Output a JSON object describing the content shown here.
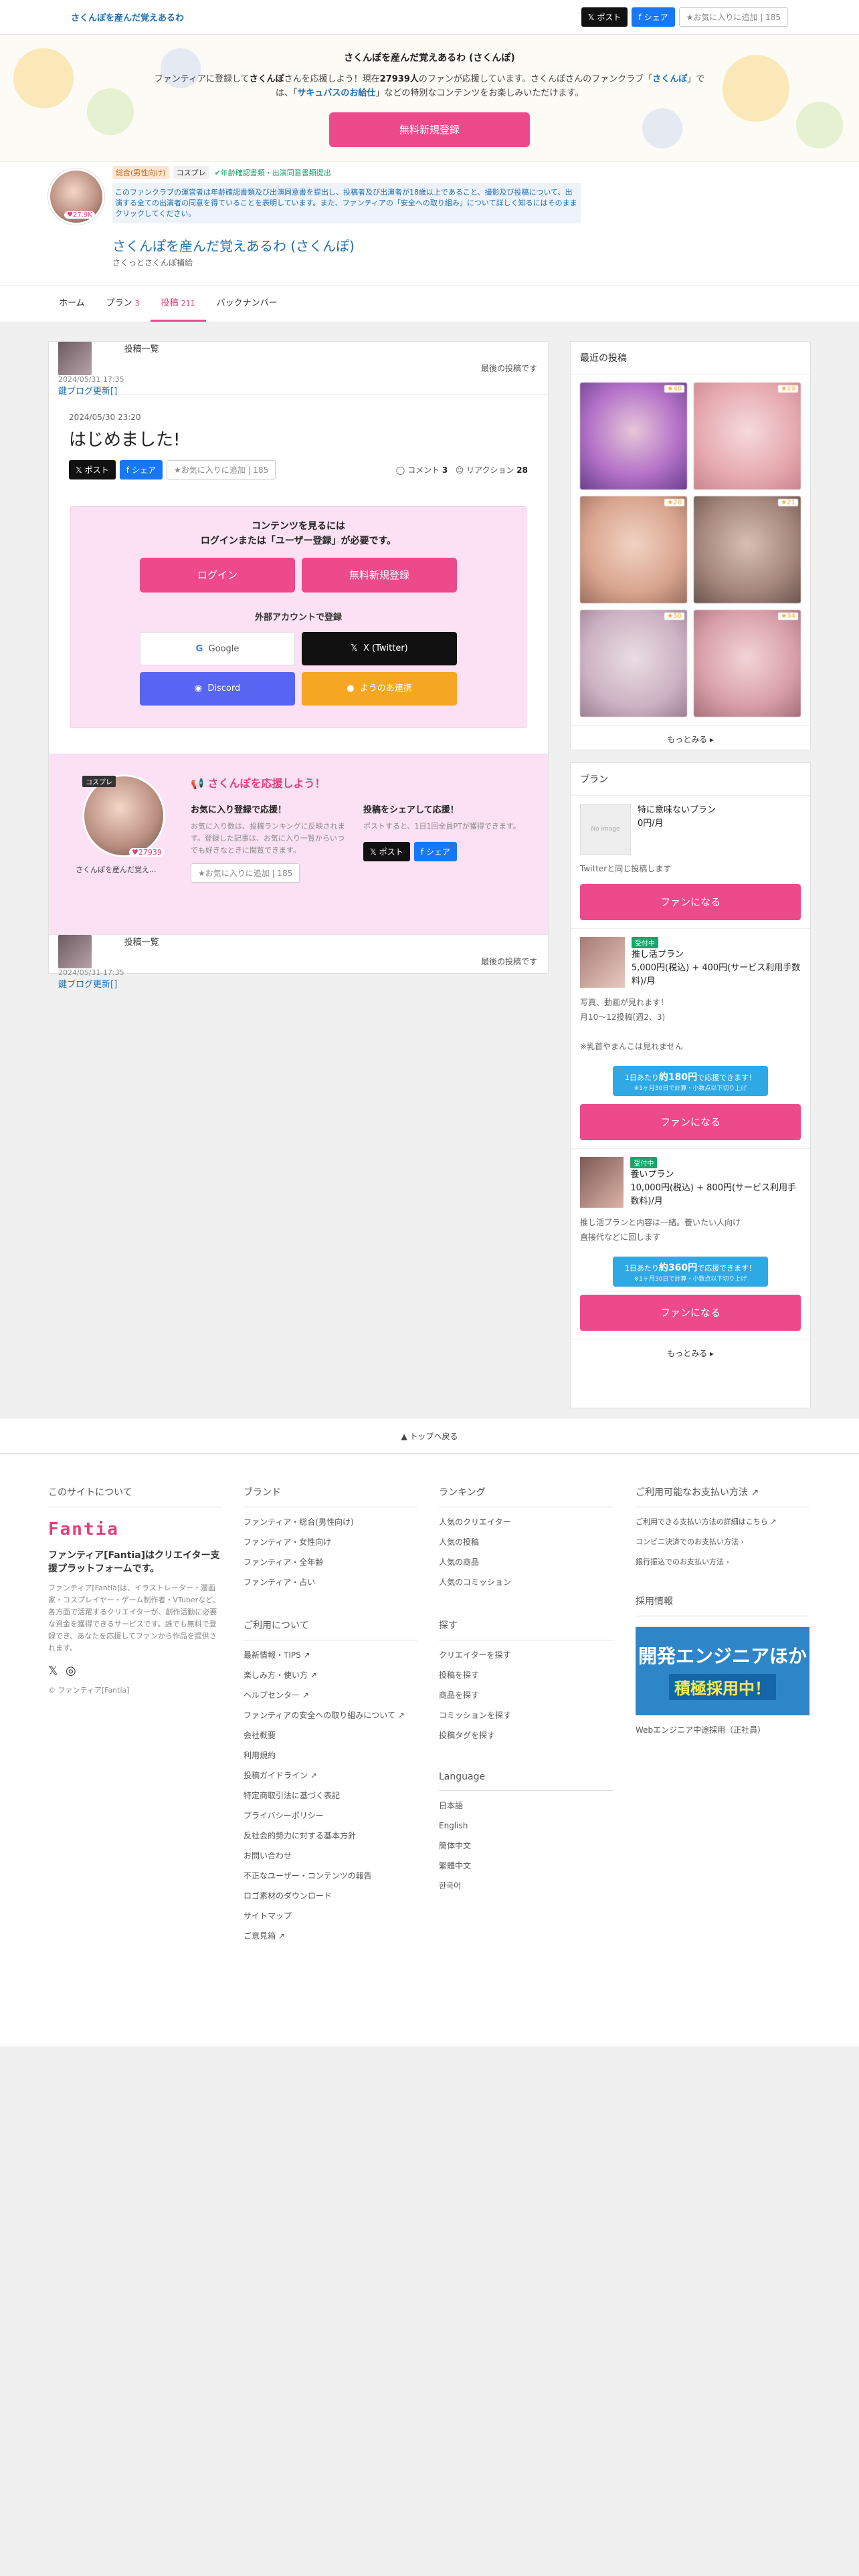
{
  "topbar": {
    "title": "さくんぽを産んだ覚えあるわ",
    "x": "ポスト",
    "fb": "シェア",
    "fav": "★お気に入りに追加 | 185"
  },
  "hero": {
    "title": "さくんぽを産んだ覚えあるわ (さくんぽ)",
    "line1": "ファンティアに登録して",
    "name": "さくんぽ",
    "line2": "さんを応援しよう！現在",
    "count": "27939人",
    "line3": "のファンが応援しています。さくんぽさんのファンクラブ「",
    "club": "さくんぽ",
    "line4": "」では、「",
    "link": "サキュバスのお給仕",
    "line5": "」などの特別なコンテンツをお楽しみいただけます。",
    "cta": "無料新規登録"
  },
  "profile": {
    "count": "27.9K",
    "tag1": "総合(男性向け)",
    "tag2": "コスプレ",
    "verified": "✔年齢確認書類・出演同意書類提出",
    "notice": "このファンクラブの運営者は年齢確認書類及び出演同意書を提出し、投稿者及び出演者が18歳以上であること、撮影及び投稿について、出演する全ての出演者の同意を得ていることを表明しています。また、ファンティアの「安全への取り組み」について詳しく知るにはそのままクリックしてください。",
    "name": "さくんぽを産んだ覚えあるわ (さくんぽ)",
    "sub": "さくっとさくんぽ補給"
  },
  "tabs": [
    {
      "label": "ホーム",
      "count": ""
    },
    {
      "label": "プラン",
      "count": "3"
    },
    {
      "label": "投稿",
      "count": "211"
    },
    {
      "label": "バックナンバー",
      "count": ""
    }
  ],
  "postnav": {
    "date": "2024/05/31 17:35",
    "title": "鍵ブログ更新[]",
    "list": "投稿一覧",
    "latest": "最後の投稿です"
  },
  "post": {
    "date": "2024/05/30 23:20",
    "title": "はじめました!",
    "x": "ポスト",
    "fb": "シェア",
    "fav": "★お気に入りに追加 | 185",
    "comment": "コメント",
    "comment_n": "3",
    "reaction": "リアクション",
    "reaction_n": "28"
  },
  "lock": {
    "l1": "コンテンツを見るには",
    "l2": "ログインまたは「ユーザー登録」が必要です。",
    "login": "ログイン",
    "register": "無料新規登録",
    "ext": "外部アカウントで登録",
    "google": "Google",
    "x": "X (Twitter)",
    "discord": "Discord",
    "other": "ようのあ連携"
  },
  "support": {
    "tag": "コスプレ",
    "count": "27939",
    "name": "さくんぽを産んだ覚え...",
    "heading": "さくんぽを応援しよう！",
    "fav_t": "お気に入り登録で応援！",
    "fav_d": "お気に入り数は、投稿ランキングに反映されます。登録した記事は、お気に入り一覧からいつでも好きなときに閲覧できます。",
    "fav_btn": "★お気に入りに追加 | 185",
    "share_t": "投稿をシェアして応援！",
    "share_d": "ポストすると、1日1回全員PTが獲得できます。",
    "x": "ポスト",
    "fb": "シェア"
  },
  "recent": {
    "title": "最近の投稿",
    "items": [
      {
        "star": "40",
        "color": "#b574c9"
      },
      {
        "star": "19",
        "color": "#e6aab0"
      },
      {
        "star": "28",
        "color": "#d9a58f"
      },
      {
        "star": "21",
        "color": "#a4867c"
      },
      {
        "star": "50",
        "color": "#cdb3c3"
      },
      {
        "star": "34",
        "color": "#d89fa9"
      }
    ],
    "more": "もっとみる ▸"
  },
  "plans": {
    "title": "プラン",
    "p1": {
      "img": "No image",
      "name": "特に意味ないプラン",
      "price": "0円/月",
      "desc": "Twitterと同じ投稿します",
      "btn": "ファンになる"
    },
    "p2": {
      "badge": "受付中",
      "name": "推し活プラン",
      "price": "5,000円(税込) + 400円(サービス利用手数料)/月",
      "desc1": "写真、動画が見れます！",
      "desc2": "月10〜12投稿(週2、3)",
      "desc3": "※乳首やまんこは見れません",
      "daily1": "1日あたり",
      "daily2": "約180円",
      "daily3": "で応援できます！",
      "dailys": "※1ヶ月30日で計算・小数点以下切り上げ",
      "btn": "ファンになる"
    },
    "p3": {
      "badge": "受付中",
      "name": "養いプラン",
      "price": "10,000円(税込) + 800円(サービス利用手数料)/月",
      "desc1": "推し活プランと内容は一緒。養いたい人向け",
      "desc2": "直接代などに回します",
      "daily1": "1日あたり",
      "daily2": "約360円",
      "daily3": "で応援できます！",
      "dailys": "※1ヶ月30日で計算・小数点以下切り上げ",
      "btn": "ファンになる"
    },
    "more": "もっとみる ▸"
  },
  "totop": "▲ トップへ戻る",
  "footer": {
    "about": {
      "h": "このサイトについて",
      "logo": "Fantia",
      "t": "ファンティア[Fantia]はクリエイター支援プラットフォームです。",
      "d": "ファンティア[Fantia]は、イラストレーター・漫画家・コスプレイヤー・ゲーム制作者・VTuberなど、各方面で活躍するクリエイターが、創作活動に必要な資金を獲得できるサービスです。誰でも無料で登録でき、あなたを応援してファンから作品を提供されます。",
      "copy": "© ファンティア[Fantia]"
    },
    "brand": {
      "h": "ブランド",
      "items": [
        "ファンティア・総合(男性向け)",
        "ファンティア・女性向け",
        "ファンティア・全年齢",
        "ファンティア・占い"
      ]
    },
    "usage": {
      "h": "ご利用について",
      "items": [
        "最新情報・TIPS ↗",
        "楽しみ方・使い方 ↗",
        "ヘルプセンター ↗",
        "ファンティアの安全への取り組みについて ↗",
        "会社概要",
        "利用規約",
        "投稿ガイドライン ↗",
        "特定商取引法に基づく表記",
        "プライバシーポリシー",
        "反社会的勢力に対する基本方針",
        "お問い合わせ",
        "不正なユーザー・コンテンツの報告",
        "ロゴ素材のダウンロード",
        "サイトマップ",
        "ご意見箱 ↗"
      ]
    },
    "rank": {
      "h": "ランキング",
      "items": [
        "人気のクリエイター",
        "人気の投稿",
        "人気の商品",
        "人気のコミッション"
      ]
    },
    "search": {
      "h": "探す",
      "items": [
        "クリエイターを探す",
        "投稿を探す",
        "商品を探す",
        "コミッションを探す",
        "投稿タグを探す"
      ]
    },
    "lang": {
      "h": "Language",
      "items": [
        "日本語",
        "English",
        "簡体中文",
        "繁體中文",
        "한국어"
      ]
    },
    "pay": {
      "h": "ご利用可能なお支払い方法 ↗",
      "items": [
        "ご利用できる支払い方法の詳細はこちら ↗",
        "コンビニ決済でのお支払い方法 ›",
        "銀行振込でのお支払い方法 ›"
      ]
    },
    "recruit": {
      "h": "採用情報",
      "a": "開発エンジニアほか",
      "b": "積極採用中！",
      "c": "Webエンジニア中途採用（正社員）"
    }
  }
}
